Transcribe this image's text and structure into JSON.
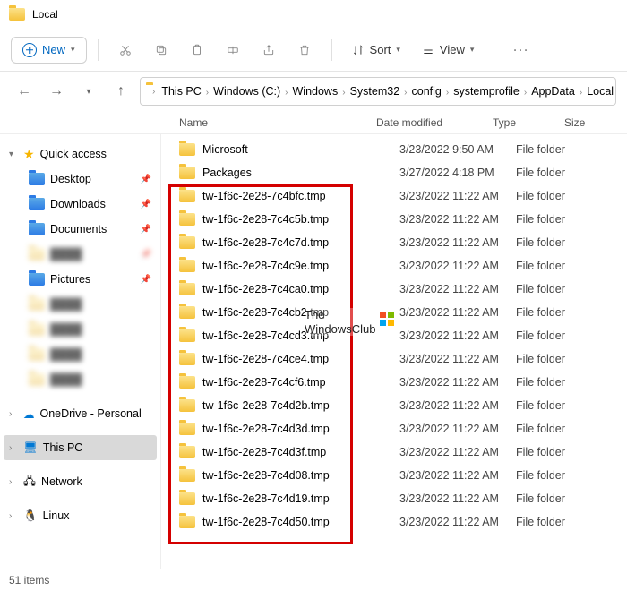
{
  "window": {
    "title": "Local"
  },
  "toolbar": {
    "new_label": "New",
    "sort_label": "Sort",
    "view_label": "View"
  },
  "breadcrumbs": [
    "This PC",
    "Windows (C:)",
    "Windows",
    "System32",
    "config",
    "systemprofile",
    "AppData",
    "Local"
  ],
  "columns": {
    "name": "Name",
    "date": "Date modified",
    "type": "Type",
    "size": "Size"
  },
  "sidebar": {
    "quick_access": "Quick access",
    "desktop": "Desktop",
    "downloads": "Downloads",
    "documents": "Documents",
    "pictures": "Pictures",
    "onedrive": "OneDrive - Personal",
    "this_pc": "This PC",
    "network": "Network",
    "linux": "Linux"
  },
  "files": [
    {
      "name": "Microsoft",
      "date": "3/23/2022 9:50 AM",
      "type": "File folder"
    },
    {
      "name": "Packages",
      "date": "3/27/2022 4:18 PM",
      "type": "File folder"
    },
    {
      "name": "tw-1f6c-2e28-7c4bfc.tmp",
      "date": "3/23/2022 11:22 AM",
      "type": "File folder"
    },
    {
      "name": "tw-1f6c-2e28-7c4c5b.tmp",
      "date": "3/23/2022 11:22 AM",
      "type": "File folder"
    },
    {
      "name": "tw-1f6c-2e28-7c4c7d.tmp",
      "date": "3/23/2022 11:22 AM",
      "type": "File folder"
    },
    {
      "name": "tw-1f6c-2e28-7c4c9e.tmp",
      "date": "3/23/2022 11:22 AM",
      "type": "File folder"
    },
    {
      "name": "tw-1f6c-2e28-7c4ca0.tmp",
      "date": "3/23/2022 11:22 AM",
      "type": "File folder"
    },
    {
      "name": "tw-1f6c-2e28-7c4cb2.tmp",
      "date": "3/23/2022 11:22 AM",
      "type": "File folder"
    },
    {
      "name": "tw-1f6c-2e28-7c4cd3.tmp",
      "date": "3/23/2022 11:22 AM",
      "type": "File folder"
    },
    {
      "name": "tw-1f6c-2e28-7c4ce4.tmp",
      "date": "3/23/2022 11:22 AM",
      "type": "File folder"
    },
    {
      "name": "tw-1f6c-2e28-7c4cf6.tmp",
      "date": "3/23/2022 11:22 AM",
      "type": "File folder"
    },
    {
      "name": "tw-1f6c-2e28-7c4d2b.tmp",
      "date": "3/23/2022 11:22 AM",
      "type": "File folder"
    },
    {
      "name": "tw-1f6c-2e28-7c4d3d.tmp",
      "date": "3/23/2022 11:22 AM",
      "type": "File folder"
    },
    {
      "name": "tw-1f6c-2e28-7c4d3f.tmp",
      "date": "3/23/2022 11:22 AM",
      "type": "File folder"
    },
    {
      "name": "tw-1f6c-2e28-7c4d08.tmp",
      "date": "3/23/2022 11:22 AM",
      "type": "File folder"
    },
    {
      "name": "tw-1f6c-2e28-7c4d19.tmp",
      "date": "3/23/2022 11:22 AM",
      "type": "File folder"
    },
    {
      "name": "tw-1f6c-2e28-7c4d50.tmp",
      "date": "3/23/2022 11:22 AM",
      "type": "File folder"
    }
  ],
  "status": {
    "count": "51 items"
  },
  "watermark": {
    "line1": "The",
    "line2": "WindowsClub"
  },
  "annotation": {
    "redbox_desc": "tmp folders highlighted"
  }
}
